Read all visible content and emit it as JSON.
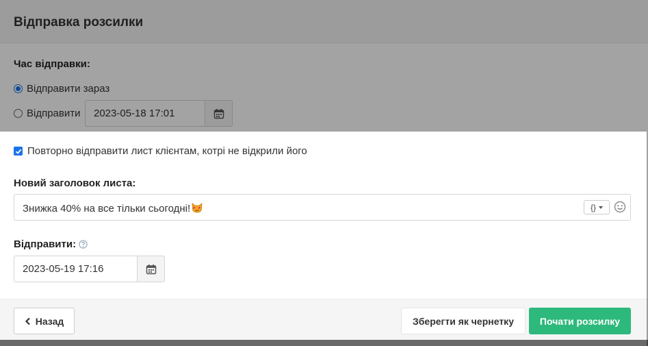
{
  "header": {
    "title": "Відправка розсилки"
  },
  "send_time": {
    "label": "Час відправки:",
    "option_now": "Відправити зараз",
    "option_later": "Відправити",
    "later_datetime": "2023-05-18 17:01"
  },
  "resend": {
    "checkbox_label": "Повторно відправити лист клієнтам, котрі не відкрили його",
    "checked": true,
    "subject_label": "Новий заголовок листа:",
    "subject_value": "Знижка 40% на все тільки сьогодні!",
    "variables_button": "{}",
    "send_label": "Відправити:",
    "send_datetime": "2023-05-19 17:16"
  },
  "icons": {
    "calendar": "calendar-icon",
    "emoji_in_subject": "cat-heart-eyes-emoji",
    "smiley": "smiley-icon",
    "help": "question-circle-icon",
    "back": "chevron-left-icon"
  },
  "footer": {
    "back_label": "Назад",
    "draft_label": "Зберегти як чернетку",
    "start_label": "Почати розсилку"
  },
  "colors": {
    "primary_blue": "#1a73e8",
    "success_green": "#2db97c",
    "header_bg": "#f5f5f5"
  }
}
